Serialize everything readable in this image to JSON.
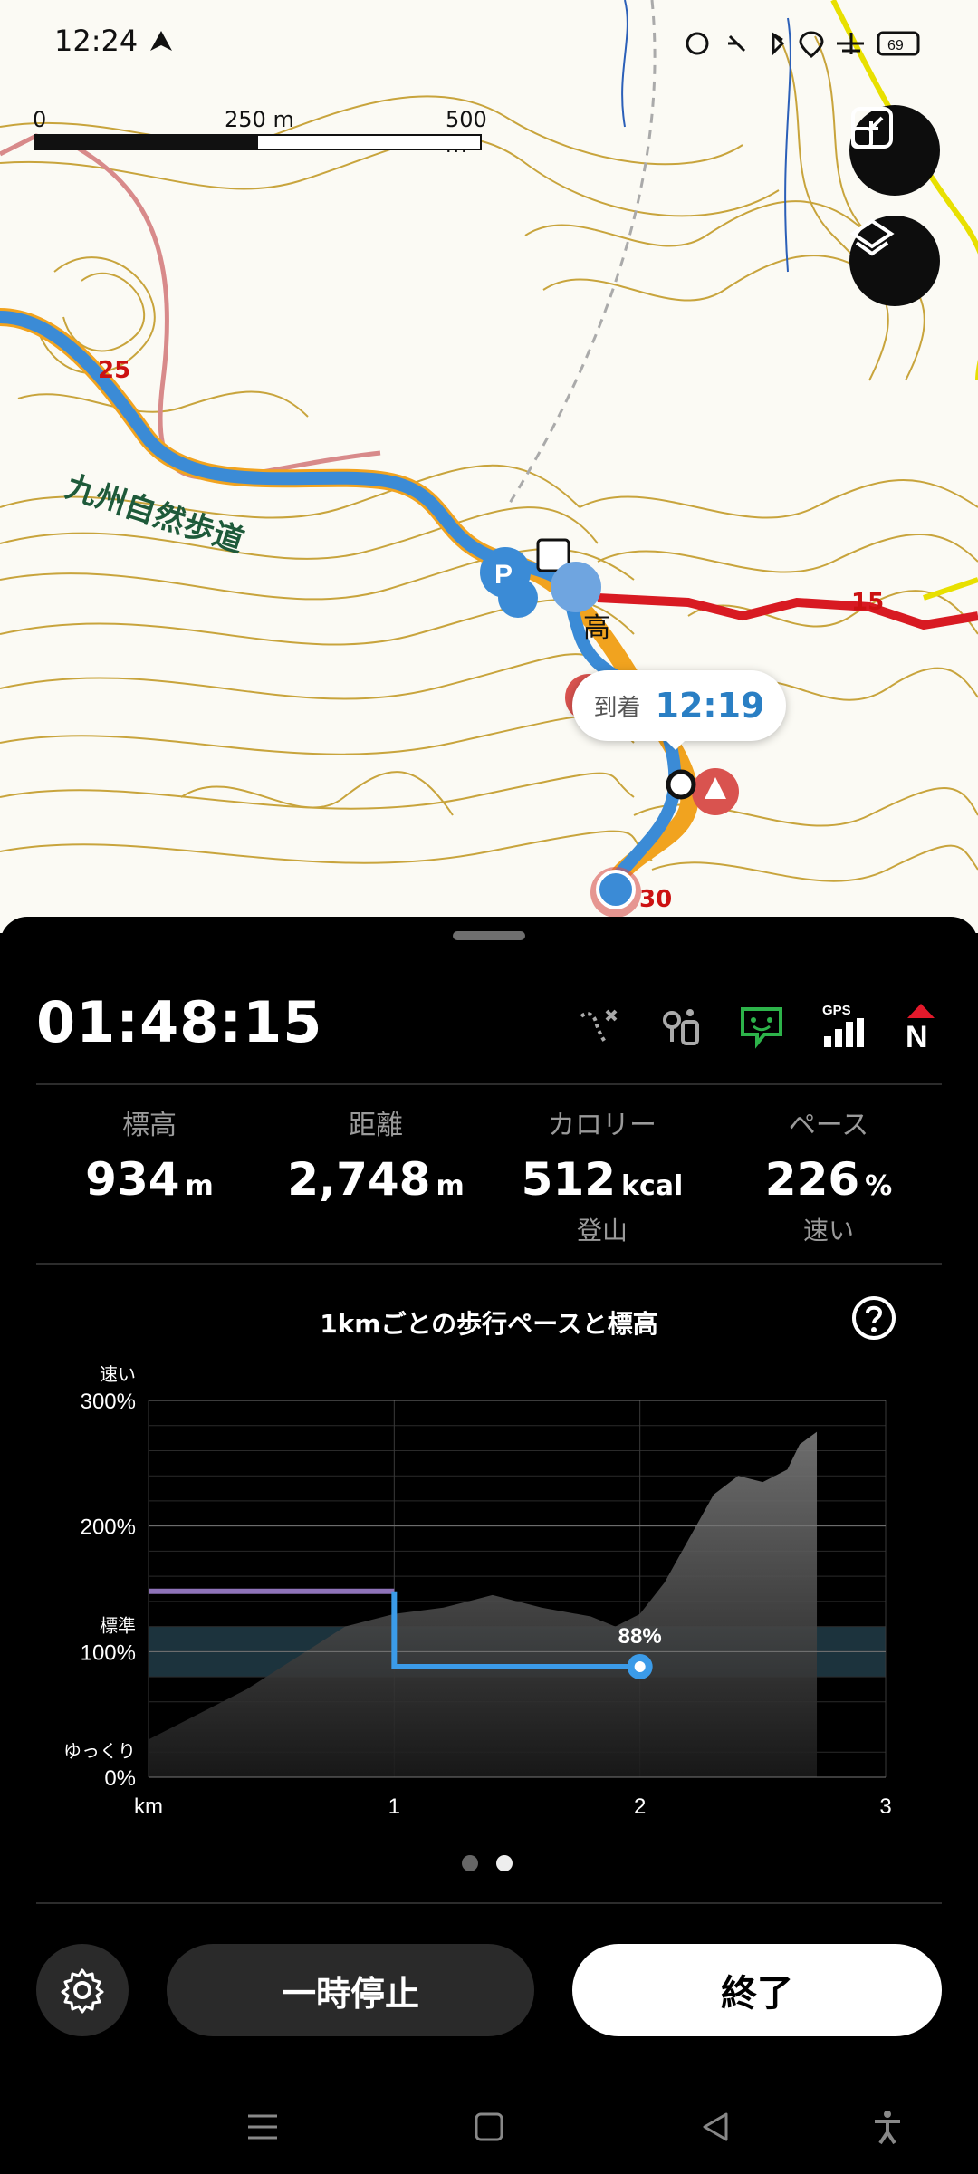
{
  "status_bar": {
    "time": "12:24",
    "battery": "69"
  },
  "map": {
    "scale": {
      "labels": [
        "0",
        "250 m",
        "500 m"
      ]
    },
    "trail_name": "九州自然歩道",
    "route_numbers": [
      "25",
      "15",
      "30"
    ],
    "place_char": "高",
    "arrival_label": "到着",
    "arrival_time": "12:19",
    "colors": {
      "route": "#3b8bd6",
      "road_red": "#d81a22",
      "contour": "#c8a43c"
    }
  },
  "panel": {
    "elapsed": "01:48:15",
    "icons": [
      "route-off-icon",
      "waypoint-icon",
      "chat-icon",
      "gps-signal-icon",
      "compass-north-icon"
    ],
    "gps_label": "GPS",
    "compass_label": "N",
    "stats": [
      {
        "label": "標高",
        "value": "934",
        "unit": "m",
        "sub": ""
      },
      {
        "label": "距離",
        "value": "2,748",
        "unit": "m",
        "sub": ""
      },
      {
        "label": "カロリー",
        "value": "512",
        "unit": "kcal",
        "sub": "登山"
      },
      {
        "label": "ペース",
        "value": "226",
        "unit": "%",
        "sub": "速い"
      }
    ],
    "chart_title": "1kmごとの歩行ペースと標高",
    "buttons": {
      "pause": "一時停止",
      "end": "終了"
    }
  },
  "chart_data": {
    "type": "line",
    "title": "1kmごとの歩行ペースと標高",
    "xlabel": "km",
    "x_ticks": [
      "km",
      "1",
      "2",
      "3"
    ],
    "y_ticks": [
      "0%",
      "100%",
      "200%",
      "300%"
    ],
    "y_annotations": {
      "fast": "速い",
      "standard": "標準",
      "slow": "ゆっくり"
    },
    "xlim": [
      0,
      3
    ],
    "ylim": [
      0,
      300
    ],
    "standard_band": [
      80,
      120
    ],
    "series": [
      {
        "name": "",
        "kind": "pace_step",
        "points": [
          [
            0,
            148
          ],
          [
            1,
            148
          ],
          [
            1,
            88
          ],
          [
            2,
            88
          ]
        ],
        "highlight": {
          "x": 2,
          "y": 88,
          "label": "88%"
        }
      },
      {
        "name": "",
        "kind": "elevation_area",
        "points": [
          [
            0,
            30
          ],
          [
            0.2,
            50
          ],
          [
            0.4,
            70
          ],
          [
            0.6,
            95
          ],
          [
            0.8,
            120
          ],
          [
            1.0,
            130
          ],
          [
            1.2,
            135
          ],
          [
            1.4,
            145
          ],
          [
            1.6,
            135
          ],
          [
            1.8,
            128
          ],
          [
            1.9,
            120
          ],
          [
            2.0,
            130
          ],
          [
            2.1,
            155
          ],
          [
            2.2,
            190
          ],
          [
            2.3,
            225
          ],
          [
            2.4,
            240
          ],
          [
            2.5,
            235
          ],
          [
            2.6,
            245
          ],
          [
            2.65,
            265
          ],
          [
            2.72,
            275
          ]
        ]
      }
    ]
  }
}
